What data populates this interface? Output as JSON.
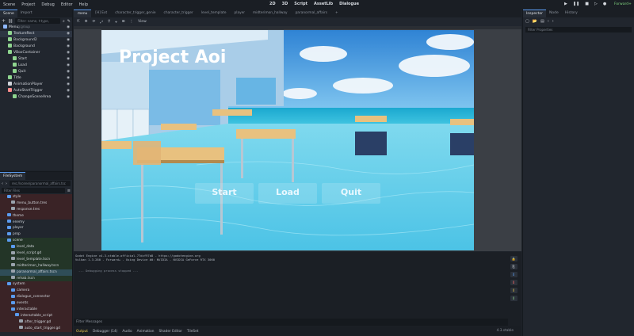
{
  "menubar": {
    "items": [
      "Scene",
      "Project",
      "Debug",
      "Editor",
      "Help"
    ],
    "workspaces": [
      "2D",
      "3D",
      "Script",
      "AssetLib",
      "Dialogue"
    ],
    "renderer": "Forward+"
  },
  "scene_dock": {
    "tabs": [
      "Scene",
      "Import"
    ],
    "filter_placeholder": "Filter: name, t:type, g:group",
    "nodes": [
      {
        "label": "Menu",
        "depth": 0,
        "color": "#8fb8ff"
      },
      {
        "label": "TextureRect",
        "depth": 1,
        "color": "#8fd58f",
        "selected": true
      },
      {
        "label": "Background2",
        "depth": 1,
        "color": "#8fd58f"
      },
      {
        "label": "Background",
        "depth": 1,
        "color": "#8fd58f"
      },
      {
        "label": "VBoxContainer",
        "depth": 1,
        "color": "#8fd58f"
      },
      {
        "label": "Start",
        "depth": 2,
        "color": "#8fd58f"
      },
      {
        "label": "Load",
        "depth": 2,
        "color": "#8fd58f"
      },
      {
        "label": "Quit",
        "depth": 2,
        "color": "#8fd58f"
      },
      {
        "label": "Title",
        "depth": 1,
        "color": "#8fd58f"
      },
      {
        "label": "AnimationPlayer",
        "depth": 1,
        "color": "#d0d4da"
      },
      {
        "label": "AutoStartTrigger",
        "depth": 1,
        "color": "#ff8c8c"
      },
      {
        "label": "ChangeSceneArea",
        "depth": 2,
        "color": "#8fd58f"
      }
    ]
  },
  "filesystem": {
    "title": "FileSystem",
    "path": "res://scene/paranormal_affairs.tsc",
    "filter_placeholder": "Filter Files",
    "items": [
      {
        "label": "style",
        "depth": 1,
        "kind": "folder",
        "tint": "red"
      },
      {
        "label": "menu_button.tres",
        "depth": 2,
        "kind": "file",
        "tint": "red"
      },
      {
        "label": "response.tres",
        "depth": 2,
        "kind": "file",
        "tint": "red"
      },
      {
        "label": "theme",
        "depth": 1,
        "kind": "folder",
        "tint": "red"
      },
      {
        "label": "enemy",
        "depth": 1,
        "kind": "folder",
        "tint": ""
      },
      {
        "label": "player",
        "depth": 1,
        "kind": "folder",
        "tint": ""
      },
      {
        "label": "prop",
        "depth": 1,
        "kind": "folder",
        "tint": ""
      },
      {
        "label": "scene",
        "depth": 1,
        "kind": "folder",
        "tint": "green"
      },
      {
        "label": "level_data",
        "depth": 2,
        "kind": "folder",
        "tint": "green"
      },
      {
        "label": "level_script.gd",
        "depth": 2,
        "kind": "file",
        "tint": "green"
      },
      {
        "label": "level_template.tscn",
        "depth": 2,
        "kind": "file",
        "tint": "green"
      },
      {
        "label": "midterimon_hallway.tscn",
        "depth": 2,
        "kind": "file",
        "tint": "green"
      },
      {
        "label": "paranormal_affairs.tscn",
        "depth": 2,
        "kind": "file",
        "tint": "sel"
      },
      {
        "label": "rehab.tscn",
        "depth": 2,
        "kind": "file",
        "tint": "green"
      },
      {
        "label": "system",
        "depth": 1,
        "kind": "folder",
        "tint": "red"
      },
      {
        "label": "camera",
        "depth": 2,
        "kind": "folder",
        "tint": "red"
      },
      {
        "label": "dialogue_connector",
        "depth": 2,
        "kind": "folder",
        "tint": "red"
      },
      {
        "label": "events",
        "depth": 2,
        "kind": "folder",
        "tint": "red"
      },
      {
        "label": "interactable",
        "depth": 2,
        "kind": "folder",
        "tint": "red"
      },
      {
        "label": "interactable_script",
        "depth": 3,
        "kind": "folder",
        "tint": "red"
      },
      {
        "label": "after_trigger.gd",
        "depth": 4,
        "kind": "file",
        "tint": "red"
      },
      {
        "label": "auto_start_trigger.gd",
        "depth": 4,
        "kind": "file",
        "tint": "red"
      }
    ]
  },
  "editor_tabs": [
    "menu",
    "[H] Ext",
    "character_trigger_genie",
    "character_trigger",
    "level_template",
    "player",
    "midterimon_hallway",
    "paranormal_affairs"
  ],
  "toolbar2": [
    "⇱",
    "✥",
    "⟳",
    "⤢",
    "⚲",
    "⌖",
    "⊞",
    "⋮",
    "View"
  ],
  "game": {
    "title": "Project Aoi",
    "buttons": [
      "Start",
      "Load",
      "Quit"
    ]
  },
  "output": {
    "lines": [
      "Godot Engine v4.3.stable.official.77dcf97d8 - https://godotengine.org",
      "Vulkan 1.3.280 - Forward+ - Using Device #0: NVIDIA - NVIDIA GeForce RTX 3060"
    ],
    "session_line": "--- Debugging process stopped ---",
    "filter_placeholder": "Filter Messages",
    "tabs": [
      "Output",
      "Debugger (14)",
      "Audio",
      "Animation",
      "Shader Editor",
      "TileSet"
    ],
    "version": "4.3.stable"
  },
  "inspector": {
    "tabs": [
      "Inspector",
      "Node",
      "History"
    ],
    "filter_placeholder": "Filter Properties"
  }
}
